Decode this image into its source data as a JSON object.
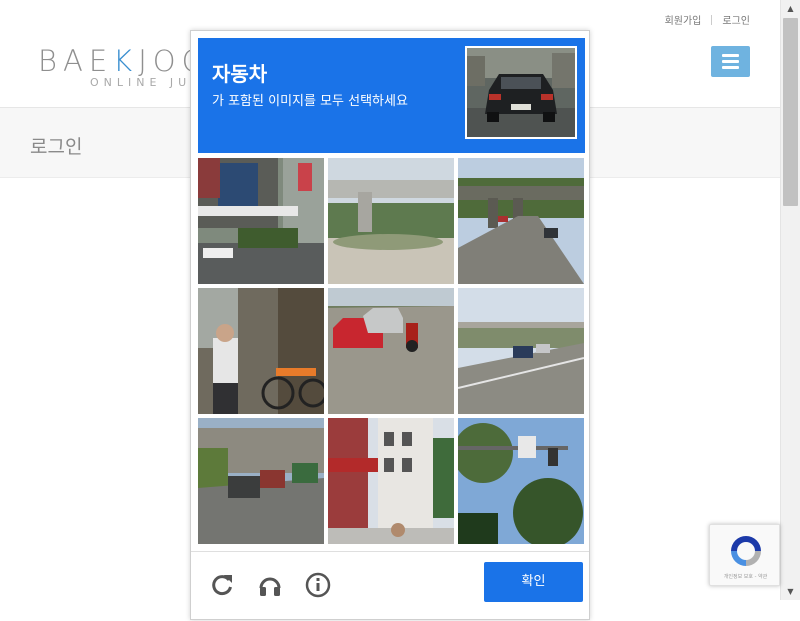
{
  "top_links": {
    "signup": "회원가입",
    "login": "로그인"
  },
  "logo": {
    "part1": "BAE",
    "accent": "K",
    "part2": "JOON",
    "tagline": "ONLINE JUDGE"
  },
  "page": {
    "title": "로그인"
  },
  "captcha": {
    "title": "자동차",
    "instruction": "가 포함된 이미지를 모두 선택하세요",
    "verify_label": "확인",
    "icons": [
      "reload-icon",
      "audio-icon",
      "info-icon"
    ]
  },
  "recaptcha_badge": {
    "text": "개인정보 보호 - 약관"
  },
  "colors": {
    "accent": "#1a73e8",
    "logo_accent": "#3a8fd0",
    "menu_button": "#6fb3e0"
  }
}
